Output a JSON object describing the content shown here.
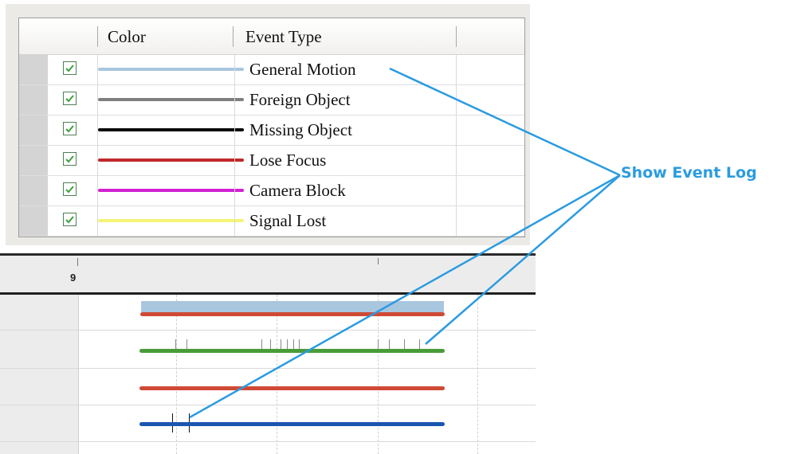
{
  "event_table": {
    "headers": {
      "color": "Color",
      "event_type": "Event Type"
    },
    "rows": [
      {
        "label": "General Motion",
        "checked": true,
        "color": "#a9c6df"
      },
      {
        "label": "Foreign Object",
        "checked": true,
        "color": "#7f7f7f"
      },
      {
        "label": "Missing Object",
        "checked": true,
        "color": "#0a0a0a"
      },
      {
        "label": "Lose Focus",
        "checked": true,
        "color": "#c1282a"
      },
      {
        "label": "Camera Block",
        "checked": true,
        "color": "#d321d3"
      },
      {
        "label": "Signal Lost",
        "checked": true,
        "color": "#f4f476"
      }
    ]
  },
  "timeline": {
    "hour_label": "9",
    "track_colors": [
      "#a9c6df",
      "#cf4a35",
      "#4a9c3a",
      "#cf4a35",
      "#1a56b0"
    ]
  },
  "annotation": {
    "label": "Show Event Log",
    "color": "#2b9be0"
  }
}
